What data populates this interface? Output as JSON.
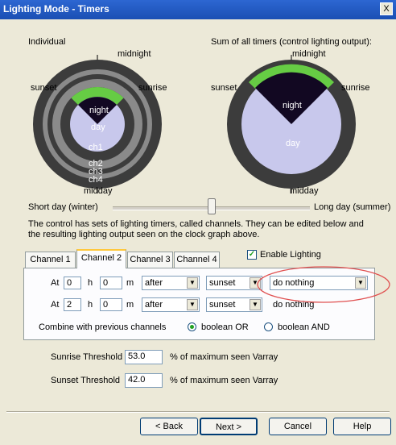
{
  "window": {
    "title": "Lighting Mode - Timers",
    "close_label": "X"
  },
  "clock": {
    "individual_label": "Individual",
    "sum_label": "Sum of all timers (control lighting output):",
    "midnight": "midnight",
    "sunset": "sunset",
    "sunrise": "sunrise",
    "midday": "midday",
    "night": "night",
    "day": "day",
    "ch1": "ch1",
    "ch2": "ch2",
    "ch3": "ch3",
    "ch4": "ch4"
  },
  "slider": {
    "left_label": "Short day (winter)",
    "right_label": "Long day (summer)",
    "level": 0.5
  },
  "description": "The control has sets of lighting timers, called channels.  They can be edited below and the resulting  lighting output seen on the clock graph above.",
  "tabs": [
    "Channel 1",
    "Channel 2",
    "Channel 3",
    "Channel 4"
  ],
  "enable_lighting": {
    "label": "Enable Lighting",
    "checked": true
  },
  "rows": [
    {
      "at": "At",
      "h_val": "0",
      "h": "h",
      "m_val": "0",
      "m": "m",
      "rel": "after",
      "event": "sunset",
      "action": "do nothing"
    },
    {
      "at": "At",
      "h_val": "2",
      "h": "h",
      "m_val": "0",
      "m": "m",
      "rel": "after",
      "event": "sunset",
      "action": "do nothing"
    }
  ],
  "combine": {
    "label": "Combine with previous channels",
    "opt1": "boolean OR",
    "opt2": "boolean AND"
  },
  "thresholds": {
    "sunrise_label": "Sunrise Threshold",
    "sunrise_value": "53.0",
    "sunset_label": "Sunset Threshold",
    "sunset_value": "42.0",
    "unit": "% of maximum seen Varray"
  },
  "buttons": {
    "back": "< Back",
    "next": "Next >",
    "cancel": "Cancel",
    "help": "Help"
  },
  "colors": {
    "title_bar": "#1a4fb3",
    "night": "#120822",
    "day": "#c8c8ec",
    "light_on": "#66cc44",
    "ring_dark": "#3c3c3c",
    "ring_mid": "#8a8a8a",
    "highlight": "#e05050"
  }
}
